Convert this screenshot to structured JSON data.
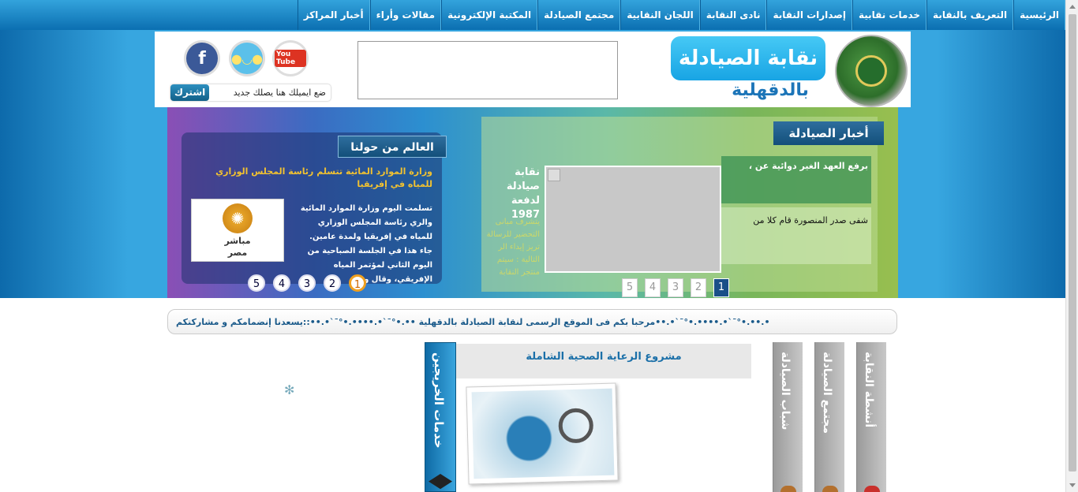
{
  "nav": {
    "items": [
      "الرئيسية",
      "التعريف بالنقابة",
      "خدمات نقابية",
      "إصدارات النقابة",
      "نادى النقابة",
      "اللجان النقابية",
      "مجتمع الصيادلة",
      "المكتبة الإلكترونية",
      "مقالات وأراء",
      "أخبار المراكز"
    ]
  },
  "header": {
    "logo_title": "نقابة الصيادلة",
    "logo_subtitle": "بالدقهلية",
    "subscribe_button": "اشترك",
    "subscribe_placeholder": "ضع ايميلك هنا يصلك جديد",
    "social": [
      "facebook-icon",
      "twitter-icon",
      "youtube-icon"
    ],
    "youtube_label": "You Tube",
    "facebook_label": "f"
  },
  "world": {
    "title": "العالم من حولنا",
    "headline": "وزارة الموارد المائية تتسلم رئاسة المجلس الوزاري للمياه في إفريقيا",
    "body": "تسلمت اليوم وزارة الموارد المائية والري رئاسة المجلس الوزاري للمياه في إفريقيا ولمدة عامين. جاء هذا في الجلسة الصباحية من اليوم الثاني لمؤتمر المياه الإفريقي، وقال وزير",
    "image_caption_top": "مباشر",
    "image_caption_bottom": "مصر",
    "pager": [
      "5",
      "4",
      "3",
      "2",
      "1"
    ],
    "active_page": "1"
  },
  "news": {
    "title": "أخبار الصيادلة",
    "item1": "، برفع العهد الغير دوائية عن",
    "item2": "شفى صدر المنصورة قام كلا من",
    "side_title": "نقابة صيادلة لدفعة 1987",
    "side_body": "يتشرف مبانى التحضير للرسالة تريز إيداء الر التالية : سيتم منتجر النقابة",
    "pager": [
      "1",
      "2",
      "3",
      "4",
      "5"
    ],
    "active_page": "1"
  },
  "marquee": {
    "text": "•.••.•°¯`•.••••.•°¯`•.••مرحبا بكم فى الموقع الرسمى لنقابة الصيادلة بالدقهلية ••.•°¯`•.••••.•°¯`•.••::يسعدنا إنضمامكم و مشاركتكم"
  },
  "graduates": {
    "label": "خدمات الخريجين"
  },
  "project": {
    "title": "مشروع الرعاية الصحية الشاملة"
  },
  "side_tabs": [
    {
      "label": "شباب الصيادلة",
      "icon_color": "#b3702e"
    },
    {
      "label": "مجتمع الصيادلة",
      "icon_color": "#b3702e"
    },
    {
      "label": "أنشطة النقابة",
      "icon_color": "#c9302c"
    }
  ]
}
